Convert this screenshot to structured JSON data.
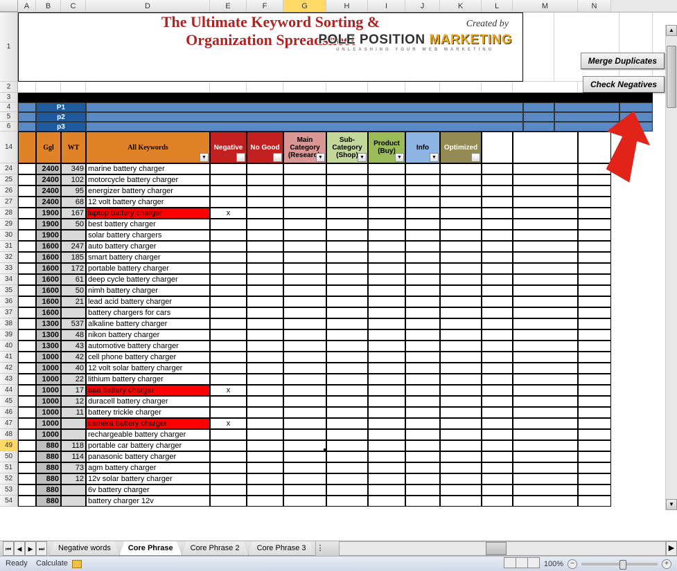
{
  "columns": [
    "A",
    "B",
    "C",
    "D",
    "E",
    "F",
    "G",
    "H",
    "I",
    "J",
    "K",
    "L",
    "M",
    "N"
  ],
  "title": "The Ultimate Keyword Sorting & Organization Spreadsheet",
  "created_by": "Created by",
  "logo": {
    "part1": "POLE POSITION",
    "part2": "MARKETING",
    "sub": "UNLEASHING YOUR WEB MARKETING"
  },
  "buttons": {
    "merge": "Merge Duplicates",
    "check": "Check Negatives"
  },
  "p_labels": [
    "P1",
    "p2",
    "p3"
  ],
  "headers": {
    "ggl": "Ggl",
    "wt": "WT",
    "all": "All Keywords",
    "neg": "Negative",
    "nogood": "No Good",
    "main": "Main Category (Research)",
    "sub": "Sub-Category (Shop)",
    "product": "Product (Buy)",
    "info": "Info",
    "opt": "Optimized"
  },
  "rows": [
    {
      "n": 24,
      "ggl": "2400",
      "wt": "349",
      "kw": "marine battery charger",
      "neg": false,
      "x": ""
    },
    {
      "n": 25,
      "ggl": "2400",
      "wt": "102",
      "kw": "motorcycle battery charger",
      "neg": false,
      "x": ""
    },
    {
      "n": 26,
      "ggl": "2400",
      "wt": "95",
      "kw": "energizer battery charger",
      "neg": false,
      "x": ""
    },
    {
      "n": 27,
      "ggl": "2400",
      "wt": "68",
      "kw": "12 volt battery charger",
      "neg": false,
      "x": ""
    },
    {
      "n": 28,
      "ggl": "1900",
      "wt": "167",
      "kw": "laptop battery charger",
      "neg": true,
      "x": "x"
    },
    {
      "n": 29,
      "ggl": "1900",
      "wt": "50",
      "kw": "best battery charger",
      "neg": false,
      "x": ""
    },
    {
      "n": 30,
      "ggl": "1900",
      "wt": "",
      "kw": "solar battery chargers",
      "neg": false,
      "x": ""
    },
    {
      "n": 31,
      "ggl": "1600",
      "wt": "247",
      "kw": "auto battery charger",
      "neg": false,
      "x": ""
    },
    {
      "n": 32,
      "ggl": "1600",
      "wt": "185",
      "kw": "smart battery charger",
      "neg": false,
      "x": ""
    },
    {
      "n": 33,
      "ggl": "1600",
      "wt": "172",
      "kw": "portable battery charger",
      "neg": false,
      "x": ""
    },
    {
      "n": 34,
      "ggl": "1600",
      "wt": "61",
      "kw": "deep cycle battery charger",
      "neg": false,
      "x": ""
    },
    {
      "n": 35,
      "ggl": "1600",
      "wt": "50",
      "kw": "nimh battery charger",
      "neg": false,
      "x": ""
    },
    {
      "n": 36,
      "ggl": "1600",
      "wt": "21",
      "kw": "lead acid battery charger",
      "neg": false,
      "x": ""
    },
    {
      "n": 37,
      "ggl": "1600",
      "wt": "",
      "kw": "battery chargers for cars",
      "neg": false,
      "x": ""
    },
    {
      "n": 38,
      "ggl": "1300",
      "wt": "537",
      "kw": "alkaline battery charger",
      "neg": false,
      "x": ""
    },
    {
      "n": 39,
      "ggl": "1300",
      "wt": "48",
      "kw": "nikon battery charger",
      "neg": false,
      "x": ""
    },
    {
      "n": 40,
      "ggl": "1300",
      "wt": "43",
      "kw": "automotive battery charger",
      "neg": false,
      "x": ""
    },
    {
      "n": 41,
      "ggl": "1000",
      "wt": "42",
      "kw": "cell phone battery charger",
      "neg": false,
      "x": ""
    },
    {
      "n": 42,
      "ggl": "1000",
      "wt": "40",
      "kw": "12 volt solar battery charger",
      "neg": false,
      "x": ""
    },
    {
      "n": 43,
      "ggl": "1000",
      "wt": "22",
      "kw": "lithium battery charger",
      "neg": false,
      "x": ""
    },
    {
      "n": 44,
      "ggl": "1000",
      "wt": "17",
      "kw": "aaa battery charger",
      "neg": true,
      "x": "x"
    },
    {
      "n": 45,
      "ggl": "1000",
      "wt": "12",
      "kw": "duracell battery charger",
      "neg": false,
      "x": ""
    },
    {
      "n": 46,
      "ggl": "1000",
      "wt": "11",
      "kw": "battery trickle charger",
      "neg": false,
      "x": ""
    },
    {
      "n": 47,
      "ggl": "1000",
      "wt": "",
      "kw": "camera battery charger",
      "neg": true,
      "x": "x"
    },
    {
      "n": 48,
      "ggl": "1000",
      "wt": "",
      "kw": "rechargeable battery charger",
      "neg": false,
      "x": ""
    },
    {
      "n": 49,
      "ggl": "880",
      "wt": "118",
      "kw": "portable car battery charger",
      "neg": false,
      "x": "",
      "sel": true
    },
    {
      "n": 50,
      "ggl": "880",
      "wt": "114",
      "kw": "panasonic battery charger",
      "neg": false,
      "x": ""
    },
    {
      "n": 51,
      "ggl": "880",
      "wt": "73",
      "kw": "agm battery charger",
      "neg": false,
      "x": ""
    },
    {
      "n": 52,
      "ggl": "880",
      "wt": "12",
      "kw": "12v solar battery charger",
      "neg": false,
      "x": ""
    },
    {
      "n": 53,
      "ggl": "880",
      "wt": "",
      "kw": "6v battery charger",
      "neg": false,
      "x": ""
    },
    {
      "n": 54,
      "ggl": "880",
      "wt": "",
      "kw": "battery charger 12v",
      "neg": false,
      "x": ""
    }
  ],
  "tabs": [
    "Negative words",
    "Core Phrase",
    "Core Phrase 2",
    "Core Phrase 3"
  ],
  "active_tab": 1,
  "status": {
    "ready": "Ready",
    "calc": "Calculate",
    "zoom": "100%"
  },
  "merged_rows": {
    "title": "1",
    "black": "3",
    "p1": "4",
    "p2": "5",
    "p3": "6",
    "hdr": "14"
  },
  "row2": "2"
}
